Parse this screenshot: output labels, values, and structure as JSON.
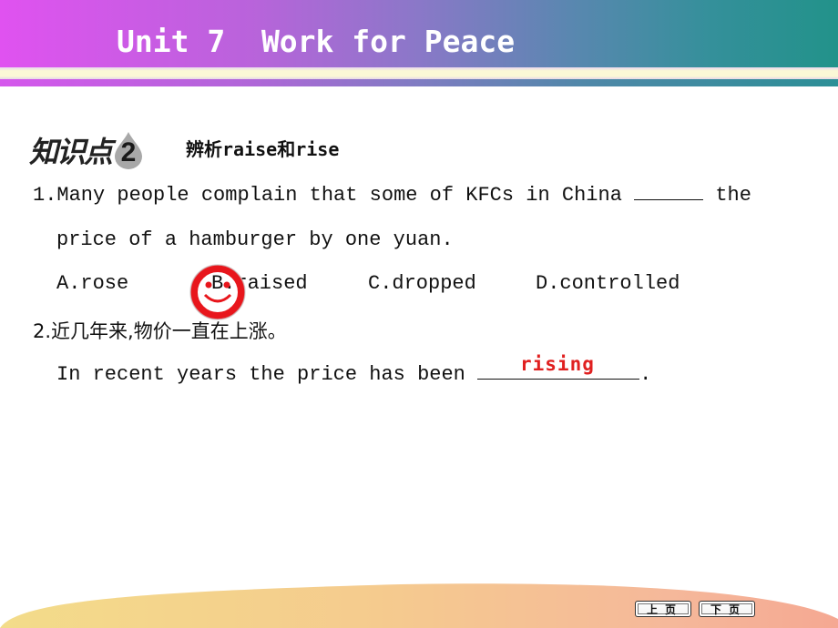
{
  "header": {
    "title": "Unit 7  Work for Peace"
  },
  "section": {
    "label": "知识点",
    "number": "2",
    "topic": "辨析raise和rise"
  },
  "questions": [
    {
      "number": "1.",
      "line1_before": "Many people complain that some of KFCs in China",
      "line1_after": "the",
      "line2": "price of a hamburger by one yuan.",
      "options": [
        {
          "label": "A.rose"
        },
        {
          "label": "B.raised"
        },
        {
          "label": "C.dropped"
        },
        {
          "label": "D.controlled"
        }
      ],
      "selected_option": "B",
      "marker_icon": "smiley-face-icon"
    },
    {
      "number": "2.",
      "chinese": "近几年来,物价一直在上涨。",
      "sentence_before": "In recent years the price has been",
      "sentence_after": ".",
      "answer": "rising"
    }
  ],
  "navigation": {
    "prev_label": "上页",
    "next_label": "下页"
  },
  "colors": {
    "header_start": "#e052f0",
    "header_end": "#22928a",
    "answer": "#e02020",
    "marker": "#e8161c"
  }
}
